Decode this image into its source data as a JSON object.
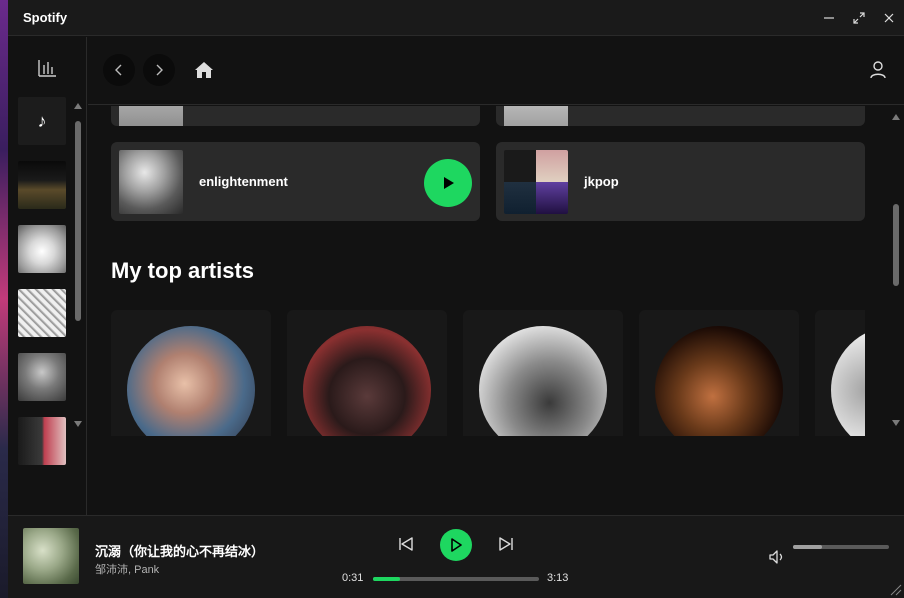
{
  "window": {
    "title": "Spotify",
    "controls": [
      "minimize-icon",
      "maximize-icon",
      "close-icon"
    ]
  },
  "rail": {
    "stats_icon": "bar-chart-icon",
    "note_icon": "♪",
    "items": [
      "music-note",
      "playlist-city",
      "playlist-sketch",
      "playlist-manga",
      "playlist-helmet",
      "playlist-collage"
    ]
  },
  "nav": {
    "back_icon": "chevron-left-icon",
    "forward_icon": "chevron-right-icon",
    "home_icon": "home-icon",
    "profile_icon": "user-icon"
  },
  "quick_cards": [
    {
      "title": "enlightenment",
      "has_play": true
    },
    {
      "title": "jkpop",
      "has_play": false
    }
  ],
  "section": {
    "title": "My top artists"
  },
  "artists": [
    {
      "name": "",
      "tone": "#5a6a8a"
    },
    {
      "name": "",
      "tone": "#7a3030"
    },
    {
      "name": "",
      "tone": "#cfcfcf"
    },
    {
      "name": "",
      "tone": "#6a3a1a"
    },
    {
      "name": "",
      "tone": "#e8e8e8"
    }
  ],
  "player": {
    "title": "沉溺（你让我的心不再结冰）",
    "artist": "邹沛沛, Pank",
    "time_current": "0:31",
    "time_total": "3:13",
    "progress": 0.16,
    "volume": 0.3
  },
  "colors": {
    "accent": "#1ed760",
    "background": "#121212",
    "card": "#2a2a2a"
  }
}
